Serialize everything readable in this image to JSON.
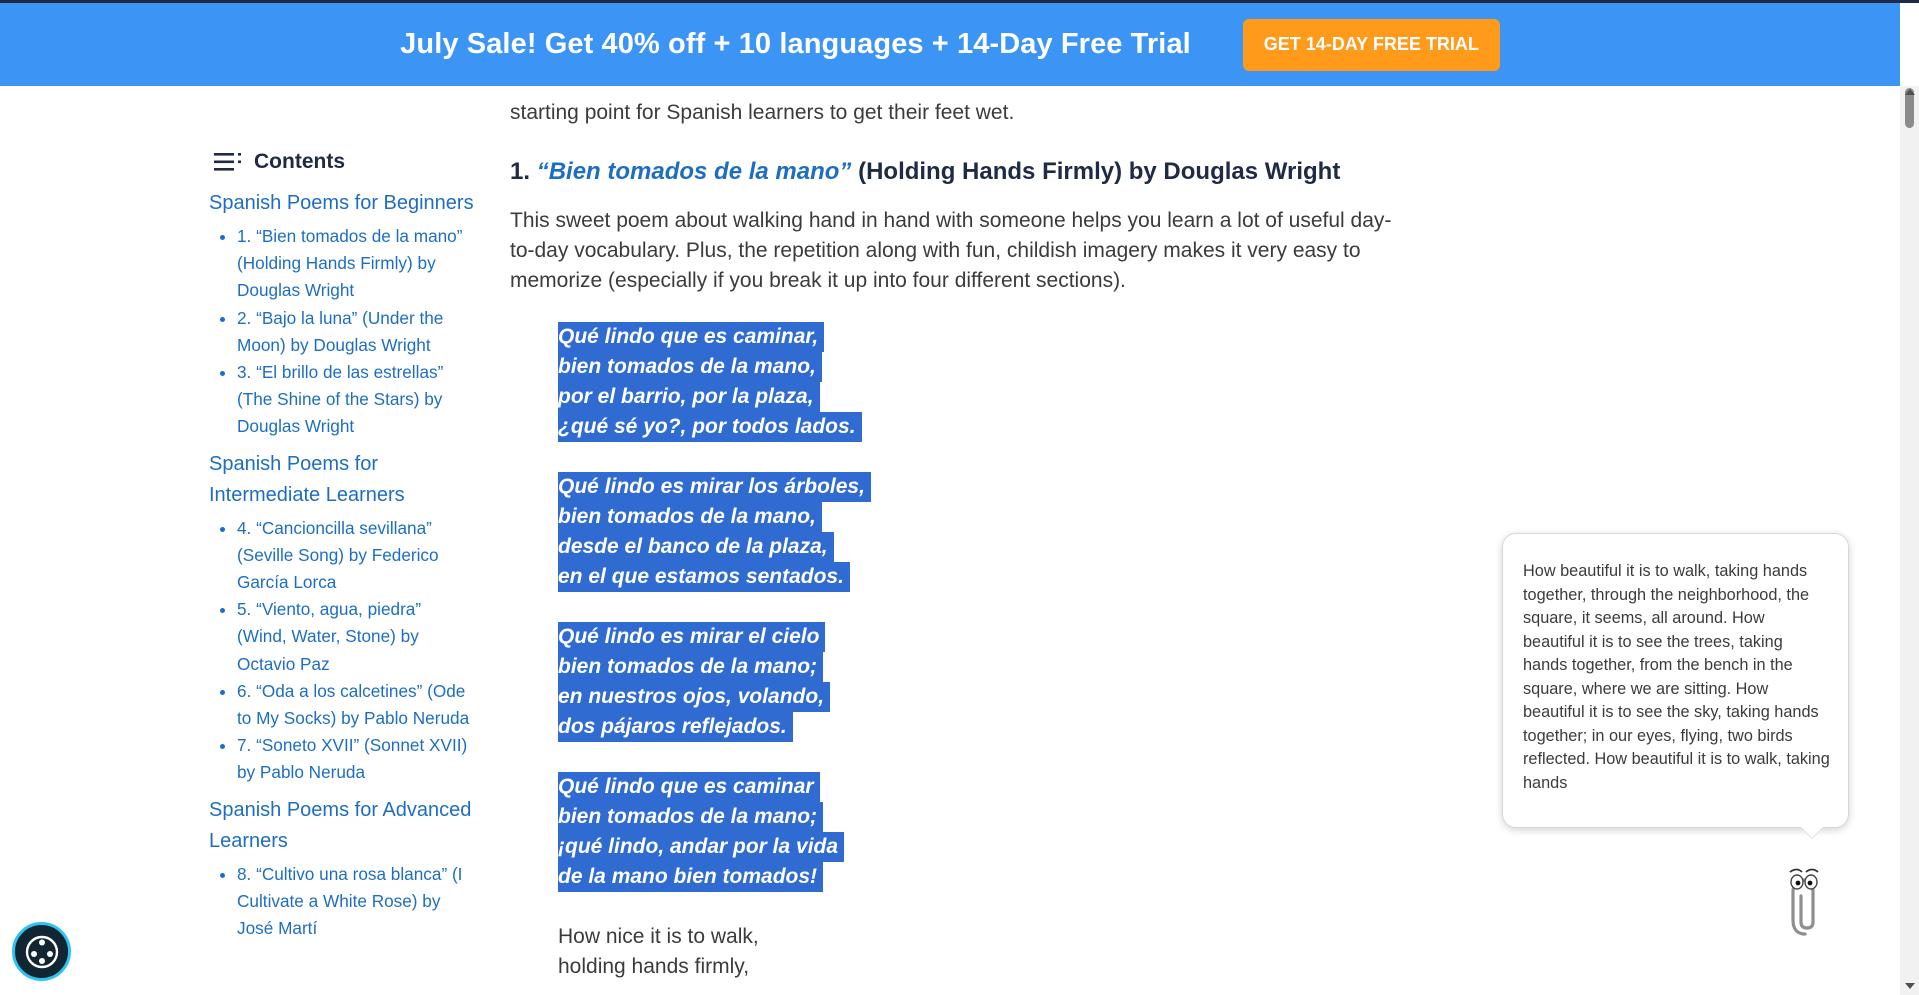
{
  "banner": {
    "text": "July Sale! Get 40% off + 10 languages + 14-Day Free Trial",
    "cta": "GET 14-DAY FREE TRIAL"
  },
  "toc": {
    "title": "Contents",
    "sections": [
      {
        "label": "Spanish Poems for Beginners",
        "items": [
          "1. “Bien tomados de la mano” (Holding Hands Firmly) by Douglas Wright",
          "2. “Bajo la luna” (Under the Moon) by Douglas Wright",
          "3. “El brillo de las estrellas” (The Shine of the Stars) by Douglas Wright"
        ]
      },
      {
        "label": "Spanish Poems for Intermediate Learners",
        "items": [
          "4. “Cancioncilla sevillana” (Seville Song) by Federico García Lorca",
          "5. “Viento, agua, piedra” (Wind, Water, Stone) by Octavio Paz",
          "6. “Oda a los calcetines” (Ode to My Socks) by Pablo Neruda",
          "7. “Soneto XVII” (Sonnet XVII) by Pablo Neruda"
        ]
      },
      {
        "label": "Spanish Poems for Advanced Learners",
        "items": [
          "8. “Cultivo una rosa blanca” (I Cultivate a White Rose) by José Martí"
        ]
      }
    ]
  },
  "article": {
    "intro_tail": "starting point for Spanish learners to get their feet wet.",
    "heading_num": "1.",
    "heading_link": "“Bien tomados de la mano”",
    "heading_rest": "(Holding Hands Firmly) by Douglas Wright",
    "paragraph": "This sweet poem about walking hand in hand with someone helps you learn a lot of useful day-to-day vocabulary. Plus, the repetition along with fun, childish imagery makes it very easy to memorize (especially if you break it up into four different sections).",
    "stanzas": [
      [
        "Qué lindo que es caminar,",
        "bien tomados de la mano,",
        "por el barrio, por la plaza,",
        "¿qué sé yo?, por todos lados."
      ],
      [
        "Qué lindo es mirar los árboles,",
        "bien tomados de la mano,",
        "desde el banco de la plaza,",
        "en el que estamos sentados."
      ],
      [
        "Qué lindo es mirar el cielo",
        "bien tomados de la mano;",
        "en nuestros ojos, volando,",
        "dos pájaros reflejados."
      ],
      [
        "Qué lindo que es caminar",
        "bien tomados de la mano;",
        "¡qué lindo, andar por la vida",
        "de la mano bien tomados!"
      ]
    ],
    "translation_lines": [
      "How nice it is to walk,",
      "holding hands firmly,"
    ]
  },
  "bubble": {
    "text": "How beautiful it is to walk, taking hands together, through the neighborhood, the square, it seems, all around. How beautiful it is to see the trees, taking hands together, from the bench in the square, where we are sitting. How beautiful it is to see the sky, taking hands together; in our eyes, flying, two birds reflected. How beautiful it is to walk, taking hands"
  },
  "colors": {
    "banner_bg": "#3c94f4",
    "cta_bg": "#ff9a1a",
    "link": "#1d6ec3",
    "selection": "#2f6bd1"
  },
  "icons": {
    "toc": "list-icon",
    "assistant": "paperclip-icon",
    "accessibility": "accessibility-icon"
  }
}
